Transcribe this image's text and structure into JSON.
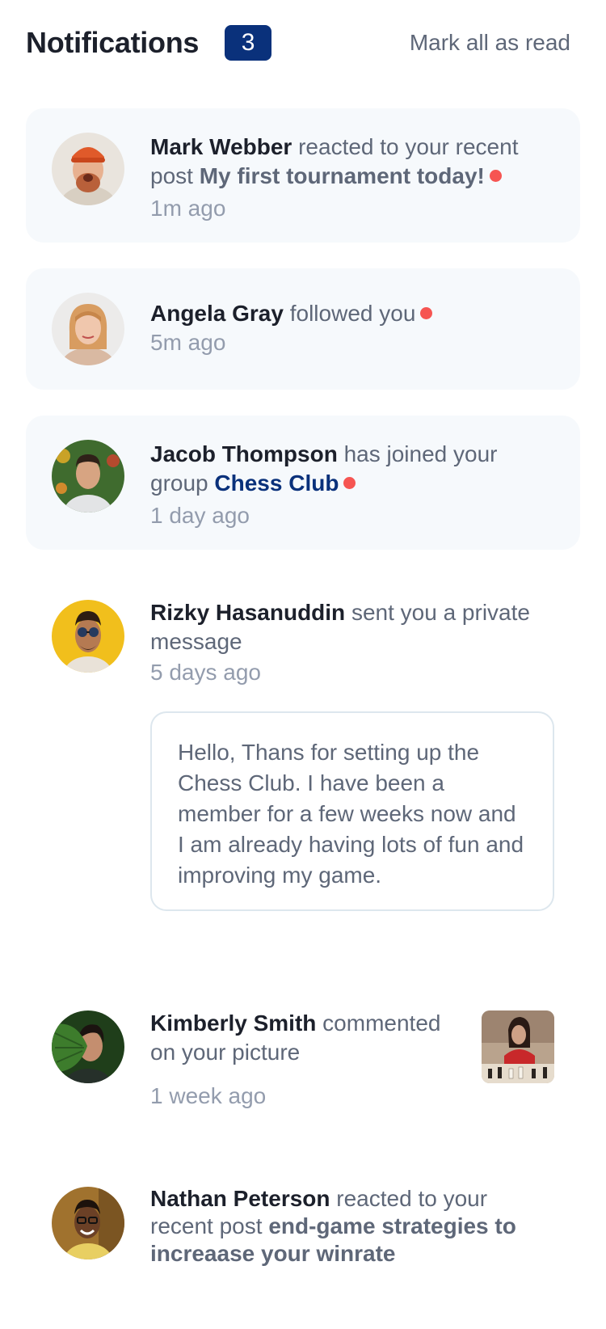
{
  "header": {
    "title": "Notifications",
    "count": "3",
    "mark_all_label": "Mark all as read"
  },
  "notifications": [
    {
      "name": "Mark Webber",
      "action": "reacted to your recent post",
      "post": "My first tournament today!",
      "time": "1m ago",
      "unread": true
    },
    {
      "name": "Angela Gray",
      "action": "followed you",
      "time": "5m ago",
      "unread": true
    },
    {
      "name": "Jacob Thompson",
      "action": "has joined your group",
      "group": "Chess Club",
      "time": "1 day ago",
      "unread": true
    },
    {
      "name": "Rizky Hasanuddin",
      "action": "sent you a private message",
      "time": "5 days ago",
      "message": "Hello, Thans for setting up the Chess Club. I have been a member for a few weeks now and I am already having lots of fun and improving my game.",
      "unread": false
    },
    {
      "name": "Kimberly Smith",
      "action": "commented on your picture",
      "time": "1 week ago",
      "unread": false
    },
    {
      "name": "Nathan Peterson",
      "action": "reacted to your recent post",
      "post": "end-game strategies to increaase your winrate",
      "unread": false
    }
  ],
  "colors": {
    "accent": "#0a317b",
    "unread_bg": "#f6f9fc",
    "dot": "#f65552",
    "text_dark": "#1c202b",
    "text_muted": "#5e6778",
    "text_light": "#939cad"
  }
}
